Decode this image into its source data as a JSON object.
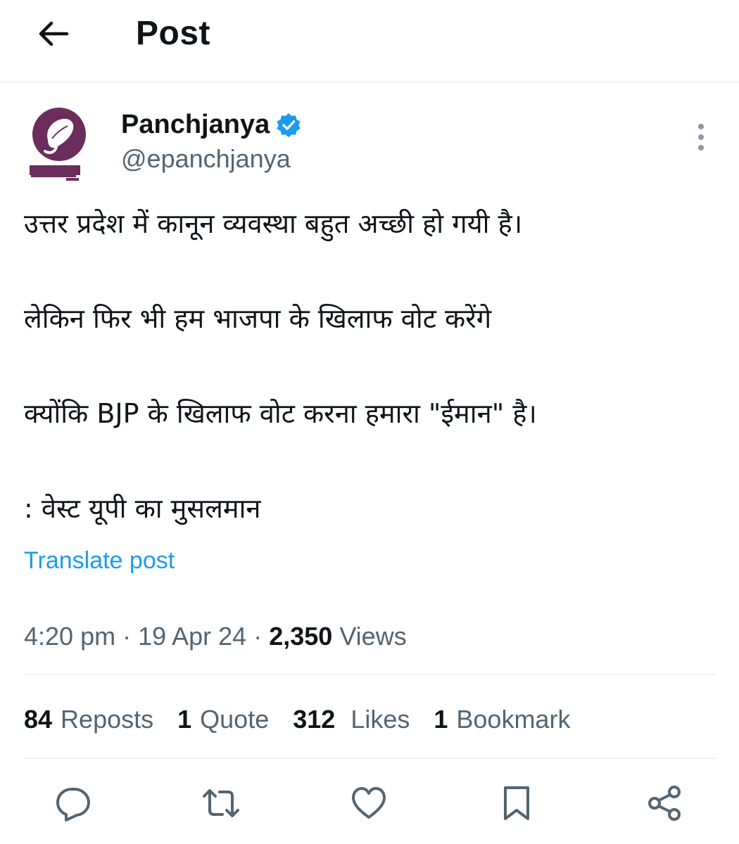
{
  "header": {
    "title": "Post",
    "back_icon": "arrow-left-icon"
  },
  "author": {
    "name": "Panchjanya",
    "handle": "@epanchjanya",
    "verified": true,
    "avatar_icon": "panchjanya-logo-icon",
    "more_icon": "more-vertical-icon"
  },
  "tweet": {
    "lines": [
      "उत्तर प्रदेश में कानून व्यवस्था बहुत अच्छी हो गयी है।",
      "लेकिन फिर भी हम भाजपा के खिलाफ वोट करेंगे",
      "क्योंकि BJP के खिलाफ वोट करना हमारा \"ईमान\" है।",
      ": वेस्ट यूपी का मुसलमान"
    ],
    "translate_label": "Translate post"
  },
  "meta": {
    "time": "4:20 pm",
    "date": "19 Apr 24",
    "separator": " · ",
    "views_count": "2,350",
    "views_label": "Views"
  },
  "stats": {
    "reposts_count": "84",
    "reposts_label": "Reposts",
    "quotes_count": "1",
    "quotes_label": "Quote",
    "likes_count": "312",
    "likes_label": "Likes",
    "bookmarks_count": "1",
    "bookmarks_label": "Bookmark"
  },
  "actions": [
    "reply-icon",
    "repost-icon",
    "like-icon",
    "bookmark-icon",
    "share-icon"
  ],
  "colors": {
    "text": "#0f1419",
    "secondary": "#536471",
    "accent": "#1d9bf0",
    "divider": "#eff3f4",
    "avatar": "#6b2d5c"
  }
}
